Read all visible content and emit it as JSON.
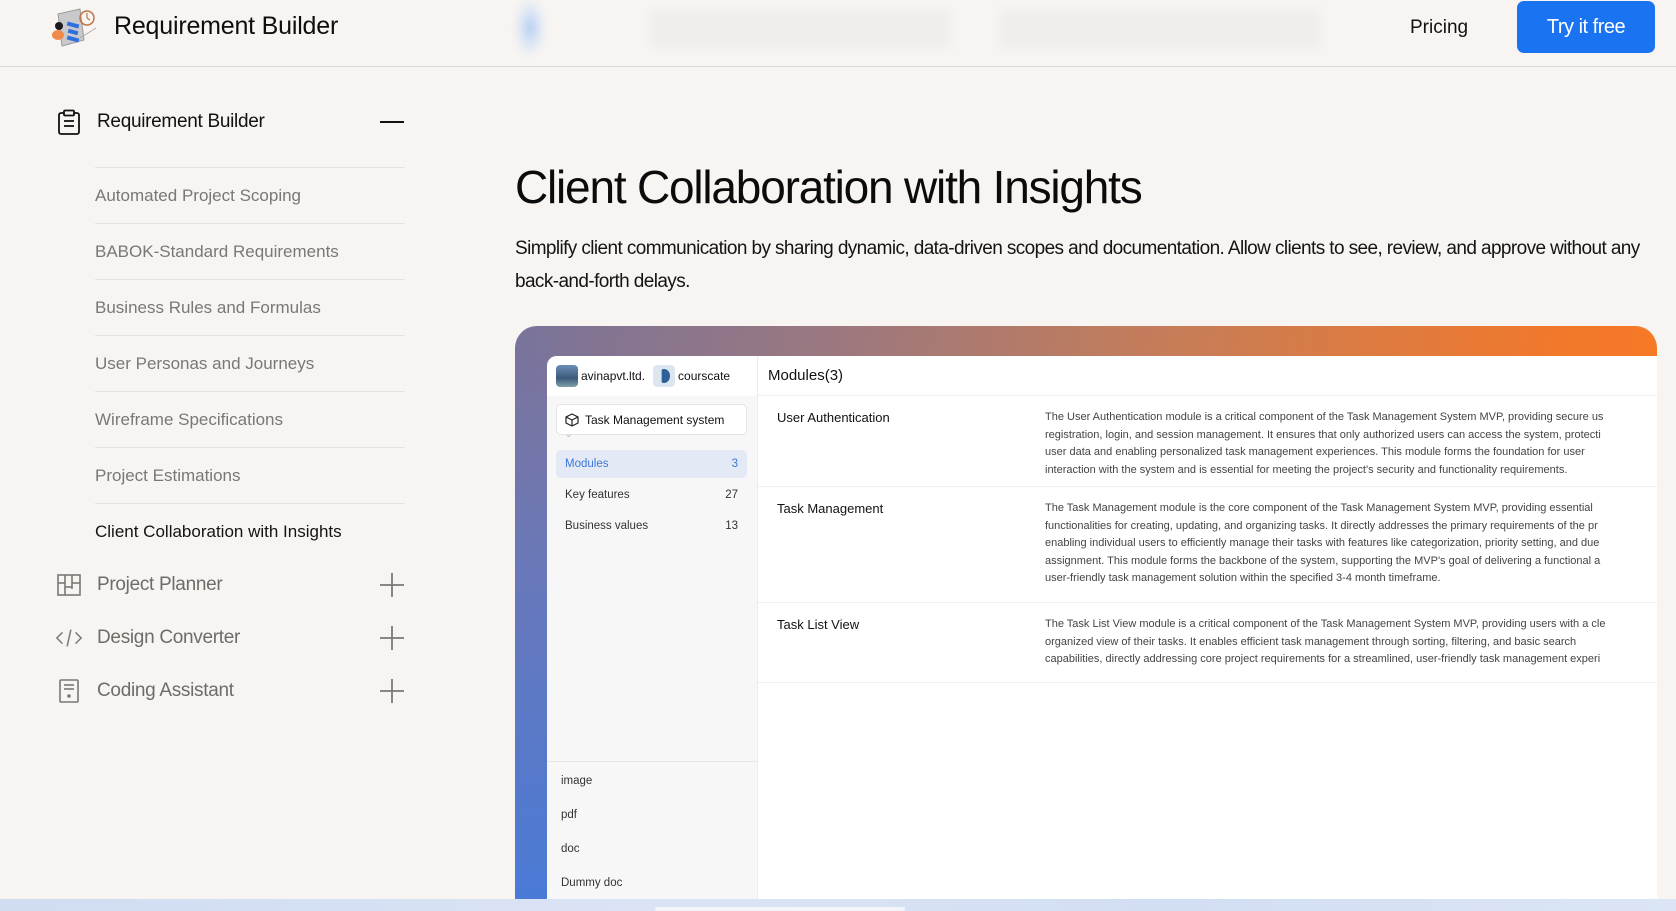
{
  "header": {
    "brand": "Requirement Builder",
    "nav": [
      {
        "label": "Pricing"
      }
    ],
    "cta_label": "Try it free",
    "cta_color": "#1a73f0"
  },
  "sidebar": {
    "groups": [
      {
        "label": "Requirement Builder",
        "icon": "clipboard-icon",
        "expanded": true,
        "toggle_icon": "minus-icon",
        "items": [
          {
            "label": "Automated Project Scoping",
            "active": false
          },
          {
            "label": "BABOK-Standard Requirements",
            "active": false
          },
          {
            "label": "Business Rules and Formulas",
            "active": false
          },
          {
            "label": "User Personas and Journeys",
            "active": false
          },
          {
            "label": "Wireframe Specifications",
            "active": false
          },
          {
            "label": "Project Estimations",
            "active": false
          },
          {
            "label": "Client Collaboration with Insights",
            "active": true
          }
        ]
      },
      {
        "label": "Project Planner",
        "icon": "board-icon",
        "expanded": false,
        "toggle_icon": "plus-icon"
      },
      {
        "label": "Design Converter",
        "icon": "code-icon",
        "expanded": false,
        "toggle_icon": "plus-icon"
      },
      {
        "label": "Coding Assistant",
        "icon": "document-icon",
        "expanded": false,
        "toggle_icon": "plus-icon"
      }
    ]
  },
  "main": {
    "title": "Client Collaboration with Insights",
    "description": "Simplify client communication by sharing dynamic, data-driven scopes and documentation. Allow clients to see, review, and approve without any back-and-forth delays."
  },
  "preview": {
    "orgs": [
      {
        "name": "avinapvt.ltd.",
        "icon": "org-avatar-landscape"
      },
      {
        "name": "courscate",
        "icon": "org-avatar-moon"
      }
    ],
    "project": {
      "name": "Task Management system",
      "icon": "cube-icon"
    },
    "nav": [
      {
        "label": "Modules",
        "count": "3",
        "active": true
      },
      {
        "label": "Key features",
        "count": "27",
        "active": false
      },
      {
        "label": "Business values",
        "count": "13",
        "active": false
      }
    ],
    "files": [
      "image",
      "pdf",
      "doc",
      "Dummy doc"
    ],
    "modules_header": "Modules(3)",
    "modules": [
      {
        "name": "User Authentication",
        "lines": [
          "The User Authentication module is a critical component of the Task Management System MVP, providing secure us",
          "registration, login, and session management. It ensures that only authorized users can access the system, protecti",
          "user data and enabling personalized task management experiences. This module forms the foundation for user",
          "interaction with the system and is essential for meeting the project's security and functionality requirements."
        ]
      },
      {
        "name": "Task Management",
        "lines": [
          "The Task Management module is the core component of the Task Management System MVP, providing essential",
          "functionalities for creating, updating, and organizing tasks. It directly addresses the primary requirements of the pr",
          "enabling individual users to efficiently manage their tasks with features like categorization, priority setting, and due",
          "assignment. This module forms the backbone of the system, supporting the MVP's goal of delivering a functional a",
          "user-friendly task management solution within the specified 3-4 month timeframe."
        ]
      },
      {
        "name": "Task List View",
        "lines": [
          "The Task List View module is a critical component of the Task Management System MVP, providing users with a cle",
          "organized view of their tasks. It enables efficient task management through sorting, filtering, and basic search",
          "capabilities, directly addressing core project requirements for a streamlined, user-friendly task management experi"
        ]
      }
    ]
  }
}
